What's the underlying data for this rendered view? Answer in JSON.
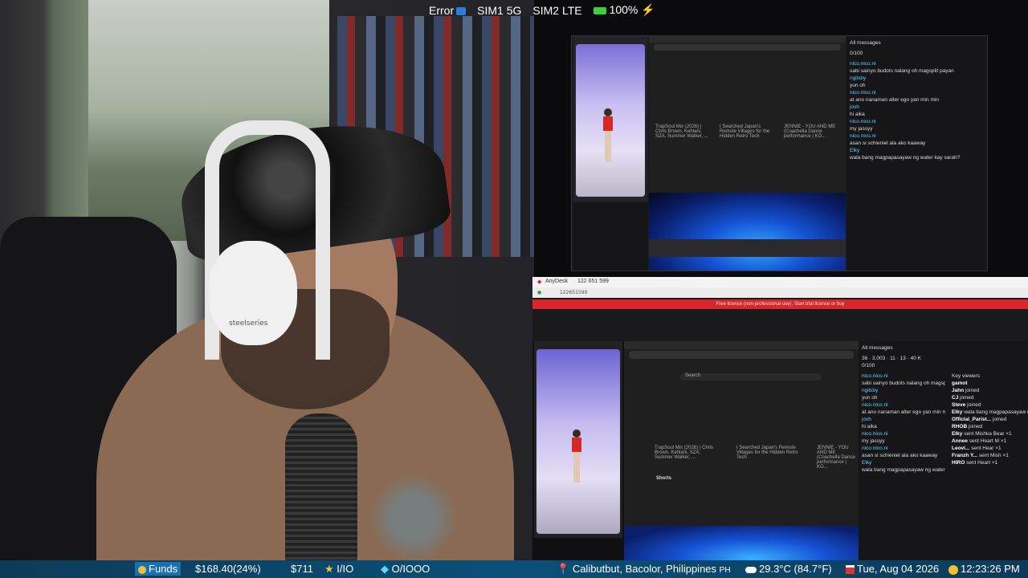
{
  "status": {
    "error_label": "Error",
    "sim1": "SIM1 5G",
    "sim2": "SIM2 LTE",
    "battery": "100%"
  },
  "camera": {
    "headphone_brand": "steelseries"
  },
  "anydesk": {
    "app_name": "AnyDesk",
    "session_id": "122 651 599",
    "address": "122651599",
    "banner": "Free license (non-professional use). Start trial license or buy"
  },
  "browser": {
    "search_placeholder": "Search",
    "video1_title": "TrapSoul Mix (2026) | Chris Brown, Kehlani, SZA, Summer Walker, ...",
    "video2_title": "I Searched Japan's Remote Villages for the Hidden Retro Tech",
    "video3_title": "JENNIE - YOU AND ME (Coachella Dance performance | KO...",
    "shorts_label": "Shorts"
  },
  "chat": {
    "header": "All messages",
    "stats": [
      "36",
      "3,003",
      "11",
      "13",
      "40 K"
    ],
    "progress": "0/100",
    "messages": [
      {
        "user": "nico.nico.ni",
        "text": "sabi sainyo budots nalang oh magsplit payan"
      },
      {
        "user": "ngilsby",
        "text": "yun oh"
      },
      {
        "user": "nico.nico.ni",
        "text": "at ano nanaman alter ego yan min min"
      },
      {
        "user": "josh",
        "text": "hi aika"
      },
      {
        "user": "nico.nico.ni",
        "text": "my jassyy"
      },
      {
        "user": "nico.nico.ni",
        "text": "asan si schieniel ala ako kaaway"
      },
      {
        "user": "Elky",
        "text": "wala bang magpapasayaw ng water kay sarah?"
      }
    ],
    "events_header": "Key viewers",
    "events": [
      {
        "user": "gamot",
        "text": ""
      },
      {
        "user": "Jahn",
        "text": "joined"
      },
      {
        "user": "CJ",
        "text": "joined"
      },
      {
        "user": "Steve",
        "text": "joined"
      },
      {
        "user": "Elky",
        "text": "wala bang magpapasayaw ng water kay sarah?"
      },
      {
        "user": "Official_Parist...",
        "text": "joined"
      },
      {
        "user": "RHOB",
        "text": "joined"
      },
      {
        "user": "Elky",
        "text": "sent Mishka Bear ×1"
      },
      {
        "user": "Annee",
        "text": "sent Heart M ×1"
      },
      {
        "user": "Leovi...",
        "text": "sent Hear ×1"
      },
      {
        "user": "Franzh Y...",
        "text": "sent Mish ×1"
      },
      {
        "user": "HIRO",
        "text": "sent Heart ×1"
      }
    ]
  },
  "ticker": {
    "funds_label": "Funds",
    "funds_value": "$168.40(24%)",
    "goal_value": "$711",
    "stars": "I/IO",
    "gems": "O/IOOO",
    "location": "Calibutbut, Bacolor, Philippines",
    "country_code": "PH",
    "weather": "29.3°C (84.7°F)",
    "date": "Tue, Aug 04 2026",
    "time": "12:23:26 PM"
  }
}
